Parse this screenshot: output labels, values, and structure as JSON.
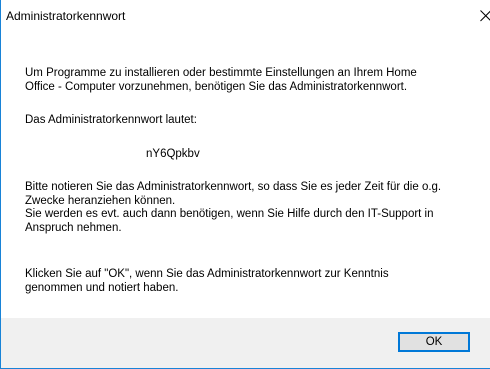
{
  "window": {
    "title": "Administratorkennwort"
  },
  "message": {
    "intro": "Um Programme zu installieren oder bestimmte Einstellungen an Ihrem Home\nOffice - Computer vorzunehmen, benötigen Sie das Administratorkennwort.",
    "password_label": "Das Administratorkennwort lautet:",
    "password_value": "nY6Qpkbv",
    "note": "Bitte notieren Sie das Administratorkennwort, so dass Sie es jeder Zeit für die o.g.\nZwecke heranziehen können.\nSie werden es evt. auch dann benötigen, wenn Sie Hilfe durch den IT-Support in\nAnspruch nehmen.",
    "confirm_hint": "Klicken Sie auf \"OK\", wenn Sie das Administratorkennwort zur Kenntnis\ngenommen und notiert haben."
  },
  "buttons": {
    "ok_label": "OK"
  },
  "colors": {
    "accent": "#0078d7",
    "footer_bg": "#f0f0f0",
    "button_bg": "#e1e1e1"
  },
  "icons": {
    "close": "close-icon"
  }
}
